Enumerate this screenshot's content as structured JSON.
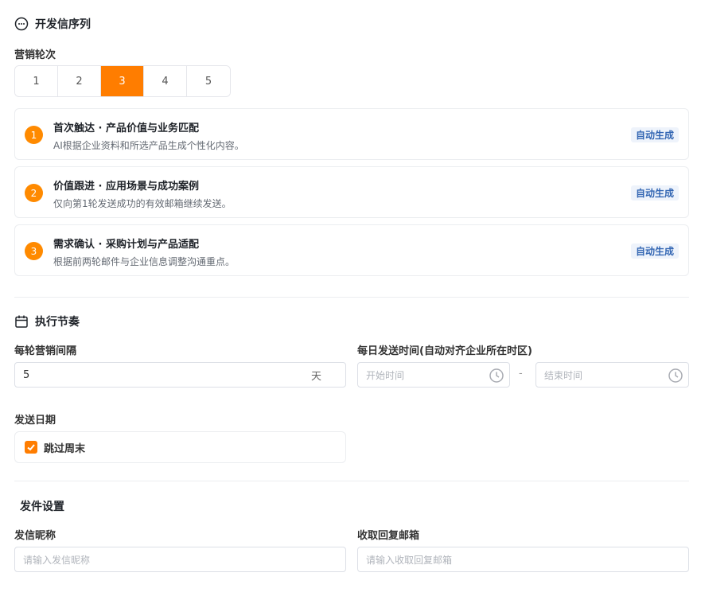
{
  "sequence": {
    "title": "开发信序列",
    "rounds_label": "营销轮次",
    "rounds": [
      "1",
      "2",
      "3",
      "4",
      "5"
    ],
    "active_round": "3",
    "steps": [
      {
        "num": "1",
        "title": "首次触达 · 产品价值与业务匹配",
        "desc": "AI根据企业资料和所选产品生成个性化内容。",
        "tag": "自动生成"
      },
      {
        "num": "2",
        "title": "价值跟进 · 应用场景与成功案例",
        "desc": "仅向第1轮发送成功的有效邮箱继续发送。",
        "tag": "自动生成"
      },
      {
        "num": "3",
        "title": "需求确认 · 采购计划与产品适配",
        "desc": "根据前两轮邮件与企业信息调整沟通重点。",
        "tag": "自动生成"
      }
    ]
  },
  "schedule": {
    "title": "执行节奏",
    "interval_label": "每轮营销间隔",
    "interval_value": "5",
    "interval_unit": "天",
    "time_label": "每日发送时间(自动对齐企业所在时区)",
    "start_placeholder": "开始时间",
    "end_placeholder": "结束时间",
    "range_separator": "-",
    "date_label": "发送日期",
    "skip_weekend_label": "跳过周末",
    "skip_weekend_checked": true
  },
  "sender": {
    "title": "发件设置",
    "nickname_label": "发信昵称",
    "nickname_placeholder": "请输入发信昵称",
    "reply_label": "收取回复邮箱",
    "reply_placeholder": "请输入收取回复邮箱"
  },
  "colors": {
    "accent": "#ff7d00",
    "tag_bg": "#eef3fb",
    "tag_text": "#3366b3"
  }
}
